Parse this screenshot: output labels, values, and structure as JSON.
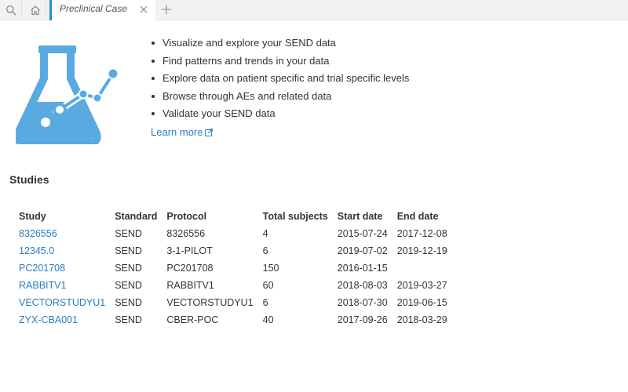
{
  "tabs": {
    "active_label": "Preclinical Case"
  },
  "colors": {
    "accent": "#2a8dd4",
    "link": "#2a7dc1",
    "flask": "#5aaae2"
  },
  "icons": {
    "search": "search-icon",
    "home": "home-icon",
    "close": "close-icon",
    "add": "plus-icon",
    "hero": "flask-chart-icon",
    "external": "external-link-icon"
  },
  "features": [
    "Visualize and explore your SEND data",
    "Find patterns and trends in your data",
    "Explore data on patient specific and trial specific levels",
    "Browse through AEs and related data",
    "Validate your SEND data"
  ],
  "learn_more": "Learn more",
  "studies": {
    "title": "Studies",
    "columns": [
      "Study",
      "Standard",
      "Protocol",
      "Total subjects",
      "Start date",
      "End date"
    ],
    "rows": [
      [
        "8326556",
        "SEND",
        "8326556",
        "4",
        "2015-07-24",
        "2017-12-08"
      ],
      [
        "12345.0",
        "SEND",
        "3-1-PILOT",
        "6",
        "2019-07-02",
        "2019-12-19"
      ],
      [
        "PC201708",
        "SEND",
        "PC201708",
        "150",
        "2016-01-15",
        ""
      ],
      [
        "RABBITV1",
        "SEND",
        "RABBITV1",
        "60",
        "2018-08-03",
        "2019-03-27"
      ],
      [
        "VECTORSTUDYU1",
        "SEND",
        "VECTORSTUDYU1",
        "6",
        "2018-07-30",
        "2019-06-15"
      ],
      [
        "ZYX-CBA001",
        "SEND",
        "CBER-POC",
        "40",
        "2017-09-26",
        "2018-03-29"
      ]
    ]
  }
}
